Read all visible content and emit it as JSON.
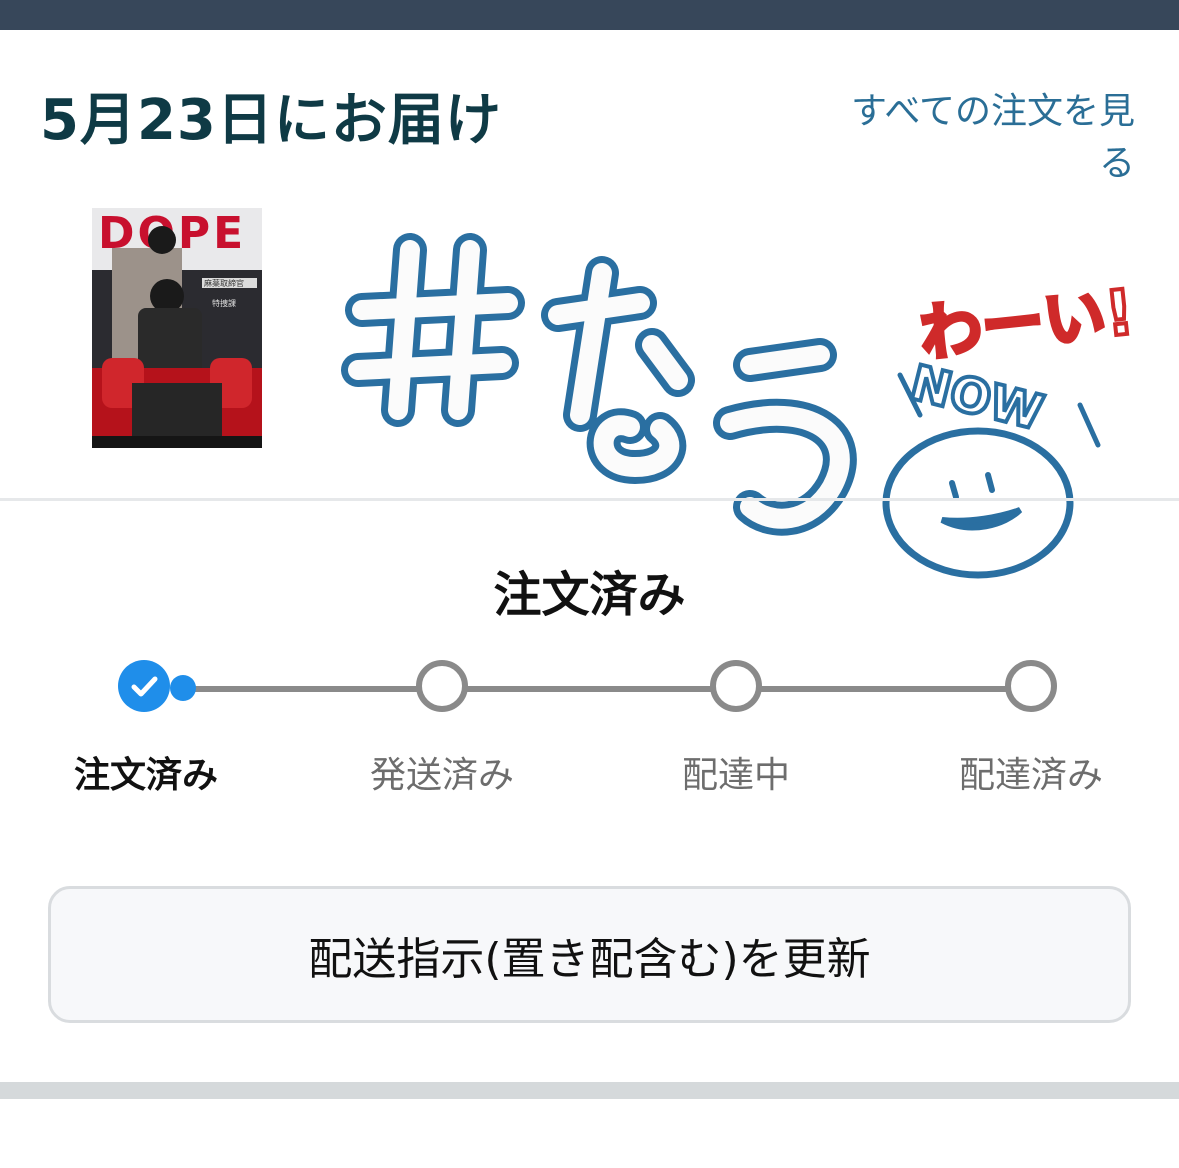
{
  "delivery": {
    "date_title": "5月23日にお届け",
    "all_orders_link": "すべての注文を見る"
  },
  "product": {
    "cover_title": "DOPE",
    "cover_subtitle_lines": [
      "麻薬取締官",
      "特捜課"
    ]
  },
  "sticker": {
    "hashtag_text": "#なう",
    "exclaim_text": "わーい!",
    "now_text": "NOW"
  },
  "status": {
    "heading": "注文済み",
    "steps": [
      {
        "label": "注文済み",
        "state": "done"
      },
      {
        "label": "発送済み",
        "state": "pending"
      },
      {
        "label": "配達中",
        "state": "pending"
      },
      {
        "label": "配達済み",
        "state": "pending"
      }
    ],
    "progress_fraction": 0
  },
  "actions": {
    "update_delivery_label": "配送指示(置き配含む)を更新"
  },
  "colors": {
    "top_bar": "#37475a",
    "title": "#0f3a45",
    "link": "#2a6e96",
    "step_done": "#1f8eea",
    "step_pending": "#8a8a8a",
    "sticker_blue": "#2a6fa1",
    "sticker_red": "#cf2a2a"
  }
}
